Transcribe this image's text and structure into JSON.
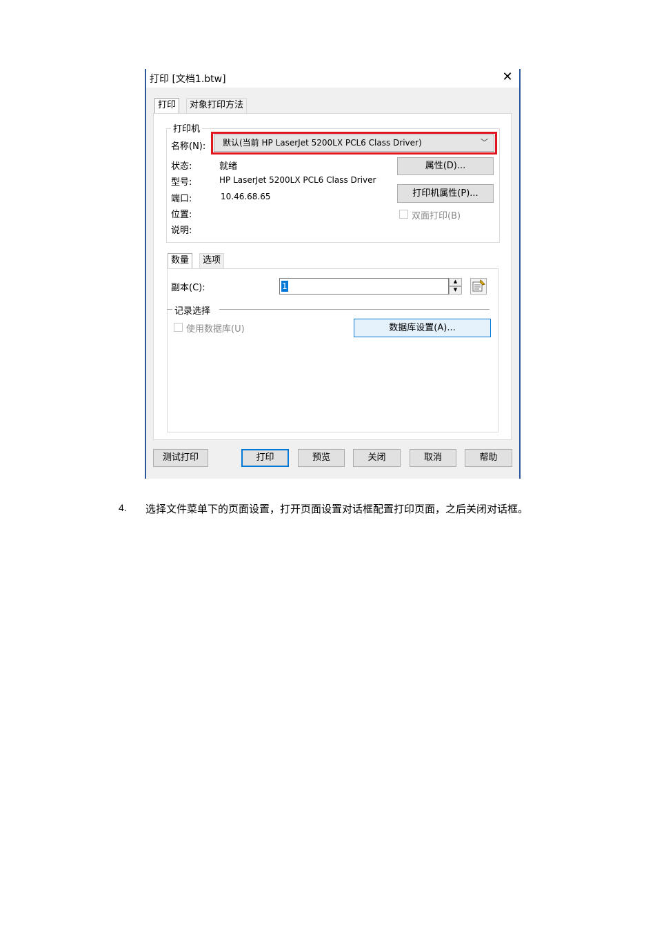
{
  "dialog": {
    "title": "打印 [文档1.btw]",
    "close_glyph": "✕"
  },
  "tabs": [
    "打印",
    "对象打印方法"
  ],
  "printer_group": {
    "legend": "打印机",
    "name_label": "名称(N):",
    "name_value": "默认(当前 HP LaserJet 5200LX PCL6 Class Driver)",
    "status_label": "状态:",
    "status_value": "就绪",
    "model_label": "型号:",
    "model_value": "HP LaserJet 5200LX PCL6 Class Driver",
    "port_label": "端口:",
    "port_value": "10.46.68.65",
    "location_label": "位置:",
    "comment_label": "说明:",
    "properties_button": "属性(D)...",
    "printer_properties_button": "打印机属性(P)...",
    "duplex_label": "双面打印(B)",
    "duplex_checked": false
  },
  "sub_tabs": [
    "数量",
    "选项"
  ],
  "quantity": {
    "copies_label": "副本(C):",
    "copies_value": "1",
    "record_legend": "记录选择",
    "use_db_label": "使用数据库(U)",
    "use_db_checked": false,
    "db_settings_button": "数据库设置(A)..."
  },
  "buttons": [
    "测试打印",
    "打印",
    "预览",
    "关闭",
    "取消",
    "帮助"
  ],
  "highlight_color": "#e0161e",
  "step": {
    "number": "4.",
    "text": "选择文件菜单下的页面设置，打开页面设置对话框配置打印页面，之后关闭对话框。"
  }
}
